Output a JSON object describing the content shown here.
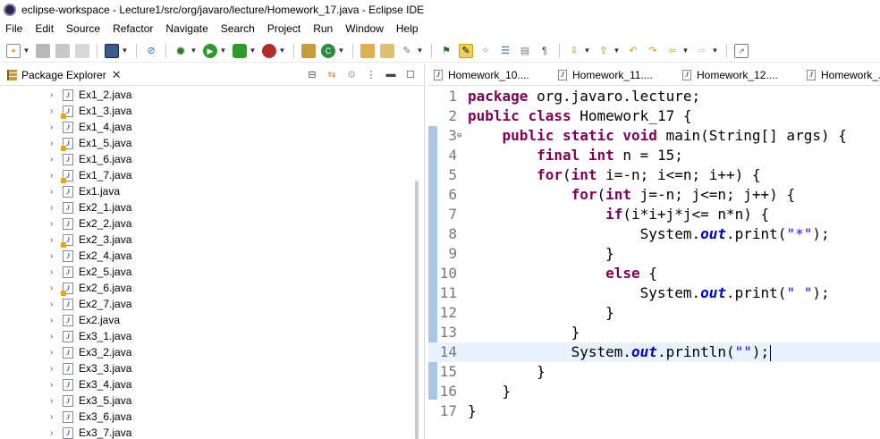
{
  "window": {
    "title": "eclipse-workspace - Lecture1/src/org/javaro/lecture/Homework_17.java - Eclipse IDE"
  },
  "menu": [
    "File",
    "Edit",
    "Source",
    "Refactor",
    "Navigate",
    "Search",
    "Project",
    "Run",
    "Window",
    "Help"
  ],
  "package_explorer": {
    "title": "Package Explorer",
    "files": [
      {
        "name": "Ex1_2.java",
        "warn": false
      },
      {
        "name": "Ex1_3.java",
        "warn": true
      },
      {
        "name": "Ex1_4.java",
        "warn": false
      },
      {
        "name": "Ex1_5.java",
        "warn": true
      },
      {
        "name": "Ex1_6.java",
        "warn": false
      },
      {
        "name": "Ex1_7.java",
        "warn": true
      },
      {
        "name": "Ex1.java",
        "warn": false
      },
      {
        "name": "Ex2_1.java",
        "warn": false
      },
      {
        "name": "Ex2_2.java",
        "warn": false
      },
      {
        "name": "Ex2_3.java",
        "warn": true
      },
      {
        "name": "Ex2_4.java",
        "warn": false
      },
      {
        "name": "Ex2_5.java",
        "warn": false
      },
      {
        "name": "Ex2_6.java",
        "warn": true
      },
      {
        "name": "Ex2_7.java",
        "warn": false
      },
      {
        "name": "Ex2.java",
        "warn": false
      },
      {
        "name": "Ex3_1.java",
        "warn": false
      },
      {
        "name": "Ex3_2.java",
        "warn": false
      },
      {
        "name": "Ex3_3.java",
        "warn": false
      },
      {
        "name": "Ex3_4.java",
        "warn": false
      },
      {
        "name": "Ex3_5.java",
        "warn": false
      },
      {
        "name": "Ex3_6.java",
        "warn": false
      },
      {
        "name": "Ex3_7.java",
        "warn": false
      }
    ]
  },
  "editor": {
    "tabs": [
      "Homework_10....",
      "Homework_11....",
      "Homework_12....",
      "Homework_..."
    ],
    "current_line": 14,
    "lines": [
      {
        "num": "1",
        "tokens": [
          {
            "t": "package",
            "c": "kw"
          },
          {
            "t": " org.javaro.lecture;",
            "c": ""
          }
        ]
      },
      {
        "num": "2",
        "tokens": [
          {
            "t": "public",
            "c": "kw"
          },
          {
            "t": " ",
            "c": ""
          },
          {
            "t": "class",
            "c": "kw"
          },
          {
            "t": " Homework_17 {",
            "c": ""
          }
        ]
      },
      {
        "num": "3",
        "fold": true,
        "tokens": [
          {
            "t": "    ",
            "c": ""
          },
          {
            "t": "public",
            "c": "kw"
          },
          {
            "t": " ",
            "c": ""
          },
          {
            "t": "static",
            "c": "kw"
          },
          {
            "t": " ",
            "c": ""
          },
          {
            "t": "void",
            "c": "kw"
          },
          {
            "t": " main(String[] args) {",
            "c": ""
          }
        ]
      },
      {
        "num": "4",
        "tokens": [
          {
            "t": "        ",
            "c": ""
          },
          {
            "t": "final",
            "c": "kw"
          },
          {
            "t": " ",
            "c": ""
          },
          {
            "t": "int",
            "c": "kw"
          },
          {
            "t": " n = 15;",
            "c": ""
          }
        ]
      },
      {
        "num": "5",
        "tokens": [
          {
            "t": "        ",
            "c": ""
          },
          {
            "t": "for",
            "c": "kw"
          },
          {
            "t": "(",
            "c": ""
          },
          {
            "t": "int",
            "c": "kw"
          },
          {
            "t": " i=-n; i<=n; i++) {",
            "c": ""
          }
        ]
      },
      {
        "num": "6",
        "tokens": [
          {
            "t": "            ",
            "c": ""
          },
          {
            "t": "for",
            "c": "kw"
          },
          {
            "t": "(",
            "c": ""
          },
          {
            "t": "int",
            "c": "kw"
          },
          {
            "t": " j=-n; j<=n; j++) {",
            "c": ""
          }
        ]
      },
      {
        "num": "7",
        "tokens": [
          {
            "t": "                ",
            "c": ""
          },
          {
            "t": "if",
            "c": "kw"
          },
          {
            "t": "(i*i+j*j<= n*n) {",
            "c": ""
          }
        ]
      },
      {
        "num": "8",
        "tokens": [
          {
            "t": "                    System.",
            "c": ""
          },
          {
            "t": "out",
            "c": "fld"
          },
          {
            "t": ".print(",
            "c": ""
          },
          {
            "t": "\"*\"",
            "c": "st"
          },
          {
            "t": ");",
            "c": ""
          }
        ]
      },
      {
        "num": "9",
        "tokens": [
          {
            "t": "                }",
            "c": ""
          }
        ]
      },
      {
        "num": "10",
        "tokens": [
          {
            "t": "                ",
            "c": ""
          },
          {
            "t": "else",
            "c": "kw"
          },
          {
            "t": " {",
            "c": ""
          }
        ]
      },
      {
        "num": "11",
        "tokens": [
          {
            "t": "                    System.",
            "c": ""
          },
          {
            "t": "out",
            "c": "fld"
          },
          {
            "t": ".print(",
            "c": ""
          },
          {
            "t": "\" \"",
            "c": "st"
          },
          {
            "t": ");",
            "c": ""
          }
        ]
      },
      {
        "num": "12",
        "tokens": [
          {
            "t": "                }",
            "c": ""
          }
        ]
      },
      {
        "num": "13",
        "tokens": [
          {
            "t": "            }",
            "c": ""
          }
        ]
      },
      {
        "num": "14",
        "tokens": [
          {
            "t": "            System.",
            "c": ""
          },
          {
            "t": "out",
            "c": "fld"
          },
          {
            "t": ".println(",
            "c": ""
          },
          {
            "t": "\"\"",
            "c": "st"
          },
          {
            "t": ");",
            "c": ""
          }
        ]
      },
      {
        "num": "15",
        "tokens": [
          {
            "t": "        }",
            "c": ""
          }
        ]
      },
      {
        "num": "16",
        "tokens": [
          {
            "t": "    }",
            "c": ""
          }
        ]
      },
      {
        "num": "17",
        "tokens": [
          {
            "t": "}",
            "c": ""
          }
        ]
      }
    ]
  },
  "colors": {
    "keyword": "#7f0055",
    "string": "#2a00ff",
    "field": "#0000c0",
    "current_line": "#e8f2fe"
  }
}
